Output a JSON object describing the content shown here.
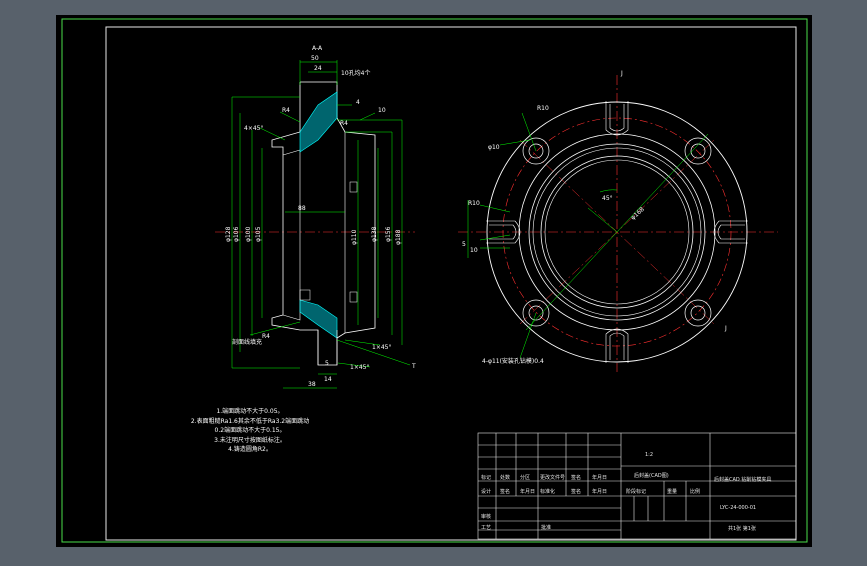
{
  "colors": {
    "background": "#58616b",
    "sheet": "#000000",
    "border": "#e8e8e8",
    "geometry": "#ffffff",
    "dimension": "#00ff00",
    "centerline": "#ff0000",
    "hatch": "#00ffff"
  },
  "drawing": {
    "section_label": "A-A",
    "view_marks": {
      "top": "J",
      "right": "J"
    },
    "section_dims": {
      "top_width_1": "50",
      "top_width_2": "24",
      "holes": "10孔均4个",
      "chamfer_note": "4×45°",
      "flange_thk": "4",
      "r_note": "10",
      "d_left_1": "φ128",
      "d_left_2": "φ106",
      "d_left_3": "φ100",
      "d_left_4": "φ105",
      "d_right_1": "φ110",
      "d_right_2": "φ138",
      "d_right_3": "φ156",
      "d_right_4": "φ188",
      "inner_w": "88",
      "lower_1": "5",
      "lower_2": "14",
      "bottom_w": "38",
      "chamfer_b1": "1×45°",
      "chamfer_b2": "1×45°",
      "hatch_note": "剖面线填充",
      "tag_t": "T",
      "r_top": "R4",
      "r_mid": "R4",
      "r_bot": "R4"
    },
    "plan_dims": {
      "r10": "R10",
      "phi10": "φ10",
      "r10b": "R10",
      "d45": "45°",
      "pcd": "φ168",
      "n5": "5",
      "s10": "10",
      "holes_note": "4-φ11(安装孔钻模)0.4"
    }
  },
  "notes": [
    "1.端面跳动不大于0.05。",
    "2.表面粗糙Ra1.6其余不低于Ra3.2端面跳动",
    "0.2端面跳动不大于0.15。",
    "3.未注明尺寸按图纸标注。",
    "4.铸造圆角R2。"
  ],
  "title_block": {
    "scale_label": "1:2",
    "part_name": "后封盖(CAD图)",
    "part_desc": "后封盖CAD 钻削钻模夹具",
    "drawing_no": "LYC-24-000-01",
    "sheet_info": "共1张 第1张",
    "headers": [
      "标记",
      "处数",
      "分区",
      "更改文件号",
      "签名",
      "年月日"
    ],
    "row2": [
      "设计",
      "签名",
      "年月日",
      "标准化",
      "签名",
      "年月日"
    ],
    "stage_label": "阶段标记",
    "weight_label": "重量",
    "scale_col": "比例",
    "review": "审核",
    "process": "工艺",
    "approve": "批准"
  }
}
